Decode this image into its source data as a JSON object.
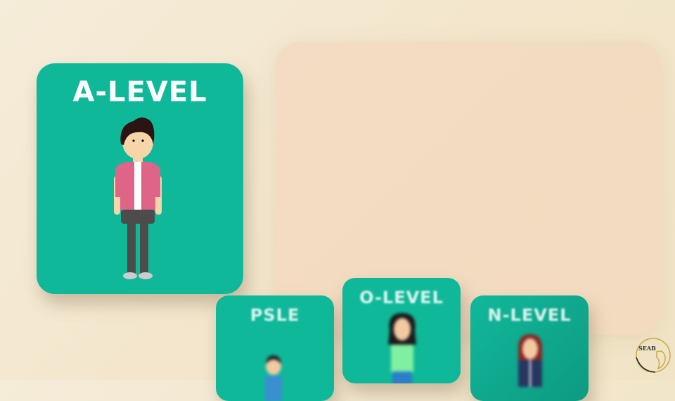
{
  "cards": {
    "a_level": {
      "title": "A-LEVEL"
    },
    "psle": {
      "title": "PSLE"
    },
    "o_level": {
      "title": "O-LEVEL"
    },
    "n_level": {
      "title": "N-LEVEL"
    }
  },
  "logo": {
    "text": "SEAB"
  },
  "colors": {
    "card": "#10b89a",
    "panel": "#f3dcc3",
    "background": "#f5ecd9"
  }
}
